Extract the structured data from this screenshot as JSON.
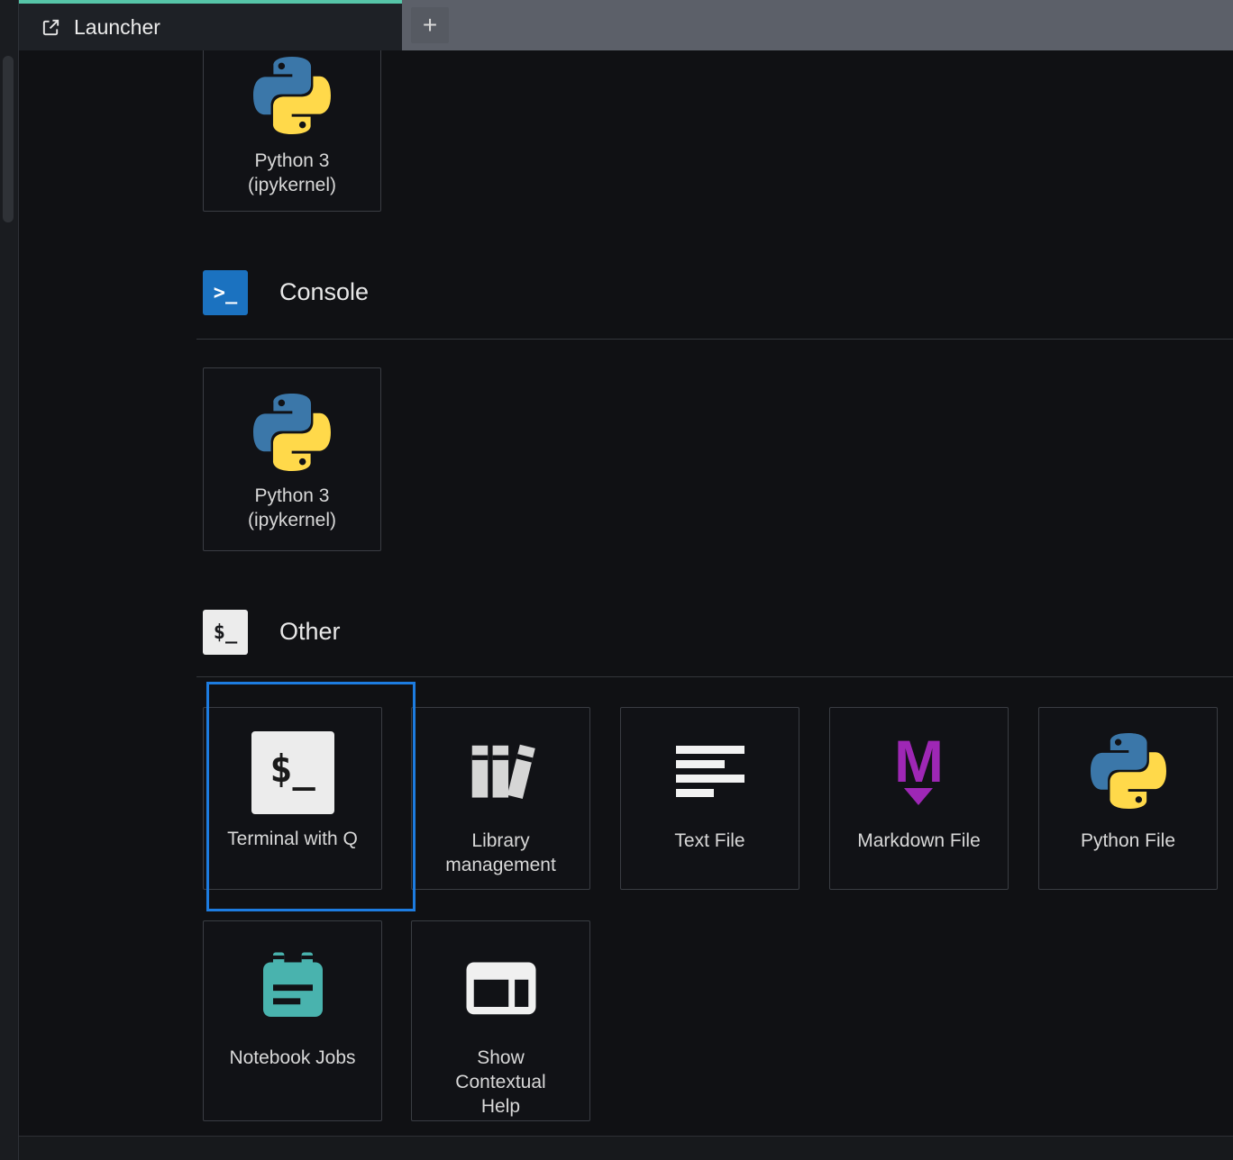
{
  "tab_bar": {
    "tabs": [
      {
        "label": "Launcher",
        "icon": "launcher-icon"
      }
    ],
    "add_button_label": "+"
  },
  "launcher": {
    "notebook_card": {
      "line1": "Python 3",
      "line2": "(ipykernel)",
      "icon": "python-icon"
    },
    "sections": [
      {
        "title": "Console",
        "icon": "console-icon",
        "icon_glyph": ">_",
        "cards": [
          {
            "line1": "Python 3",
            "line2": "(ipykernel)",
            "icon": "python-icon"
          }
        ]
      },
      {
        "title": "Other",
        "icon": "terminal-icon",
        "icon_glyph": "$_",
        "cards": [
          {
            "label": "Terminal with Q",
            "icon": "terminal-icon",
            "icon_glyph": "$_",
            "highlighted": true
          },
          {
            "label": "Library management",
            "icon": "library-books-icon"
          },
          {
            "label": "Text File",
            "icon": "text-lines-icon"
          },
          {
            "label": "Markdown File",
            "icon": "markdown-icon",
            "icon_glyph": "M"
          },
          {
            "label": "Python File",
            "icon": "python-icon"
          },
          {
            "label": "Notebook Jobs",
            "icon": "calendar-jobs-icon"
          },
          {
            "label": "Show Contextual Help",
            "icon": "contextual-help-icon"
          }
        ]
      }
    ]
  },
  "colors": {
    "tab_accent": "#56c5a8",
    "selection_border": "#1d7ce0",
    "console_icon_bg": "#1b72c0",
    "markdown_purple": "#9e27b5",
    "notebook_jobs_teal": "#49b3ae",
    "python_blue": "#3b77a9",
    "python_yellow": "#ffd94a"
  }
}
